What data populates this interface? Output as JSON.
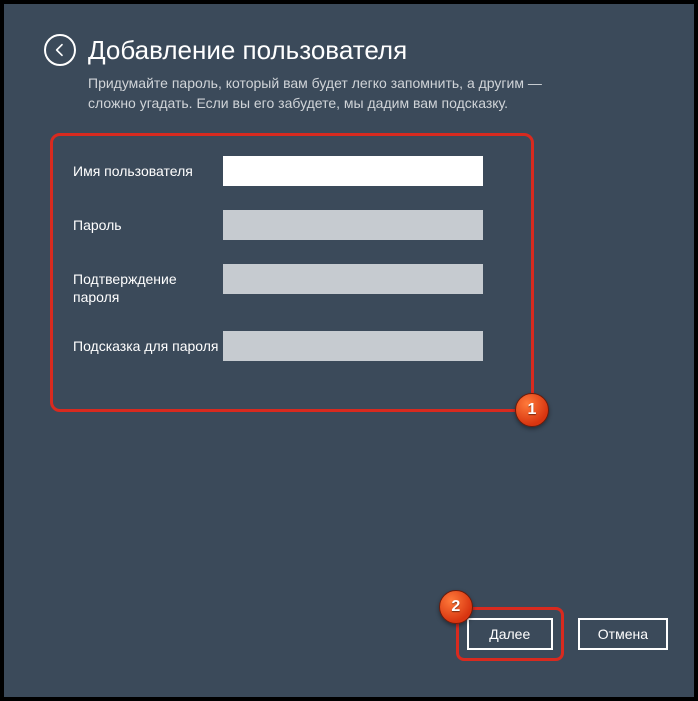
{
  "header": {
    "title": "Добавление пользователя"
  },
  "description": "Придумайте пароль, который вам будет легко запомнить, а другим — сложно угадать. Если вы его забудете, мы дадим вам подсказку.",
  "form": {
    "username": {
      "label": "Имя пользователя",
      "value": ""
    },
    "password": {
      "label": "Пароль",
      "value": ""
    },
    "confirm": {
      "label": "Подтверждение пароля",
      "value": ""
    },
    "hint": {
      "label": "Подсказка для пароля",
      "value": ""
    }
  },
  "annotations": {
    "badge1": "1",
    "badge2": "2"
  },
  "buttons": {
    "next": "Далее",
    "cancel": "Отмена"
  }
}
